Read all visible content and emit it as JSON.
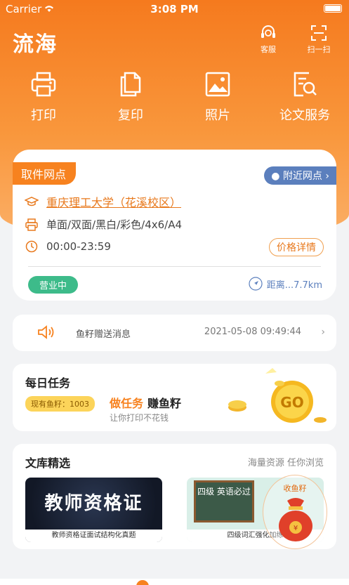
{
  "status_bar": {
    "carrier": "Carrier",
    "time": "3:08 PM"
  },
  "header": {
    "logo": "流海",
    "customer_service": "客服",
    "scan": "扫一扫"
  },
  "services": [
    {
      "label": "打印",
      "icon": "printer-icon"
    },
    {
      "label": "复印",
      "icon": "copy-icon"
    },
    {
      "label": "照片",
      "icon": "photo-icon"
    },
    {
      "label": "论文服务",
      "icon": "paper-search-icon"
    }
  ],
  "pickup": {
    "tag": "取件网点",
    "nearby": "附近网点",
    "school": "重庆理工大学（花溪校区）",
    "print_options": "单面/双面/黑白/彩色/4x6/A4",
    "hours": "00:00-23:59",
    "price_details": "价格详情",
    "status": "营业中",
    "distance": "距离...7.7km"
  },
  "notice": {
    "message": "鱼籽赠送消息",
    "date": "2021-05-08 09:49:44"
  },
  "daily_task": {
    "title": "每日任务",
    "fish_count": "现有鱼籽：1003",
    "do_task": "做任务",
    "earn": "赚鱼籽",
    "subtitle": "让你打印不花钱",
    "coin_text": "GO"
  },
  "library": {
    "title": "文库精选",
    "subtitle": "海量资源 任你浏览",
    "books": [
      {
        "cover_text": "教师资格证",
        "caption": "教师资格证面试结构化真题"
      },
      {
        "cover_text": "四级 英语必过",
        "caption": "四级词汇强化加练"
      }
    ],
    "float_badge": "收鱼籽"
  },
  "colors": {
    "brand": "#f7821f",
    "accent_blue": "#5b7fbd",
    "open_green": "#3dbb8a"
  }
}
